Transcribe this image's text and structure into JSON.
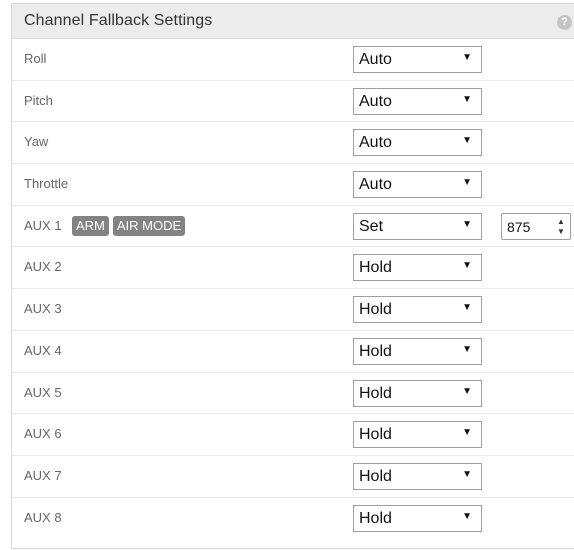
{
  "panel": {
    "title": "Channel Fallback Settings",
    "help_icon": "?"
  },
  "rows": [
    {
      "label": "Roll",
      "mode": "Auto"
    },
    {
      "label": "Pitch",
      "mode": "Auto"
    },
    {
      "label": "Yaw",
      "mode": "Auto"
    },
    {
      "label": "Throttle",
      "mode": "Auto"
    },
    {
      "label": "AUX 1",
      "badges": [
        "ARM",
        "AIR MODE"
      ],
      "mode": "Set",
      "value": "875"
    },
    {
      "label": "AUX 2",
      "mode": "Hold"
    },
    {
      "label": "AUX 3",
      "mode": "Hold"
    },
    {
      "label": "AUX 4",
      "mode": "Hold"
    },
    {
      "label": "AUX 5",
      "mode": "Hold"
    },
    {
      "label": "AUX 6",
      "mode": "Hold"
    },
    {
      "label": "AUX 7",
      "mode": "Hold"
    },
    {
      "label": "AUX 8",
      "mode": "Hold"
    }
  ],
  "glyphs": {
    "dropdown_arrow": "▼",
    "spin_up": "▲",
    "spin_down": "▼"
  },
  "icons": {
    "help": "help-icon",
    "dropdown": "dropdown-arrow-icon",
    "spinner": "spinner-icon"
  },
  "colors": {
    "header_bg": "#ececec",
    "badge_bg": "#838383",
    "label_text": "#666666"
  }
}
